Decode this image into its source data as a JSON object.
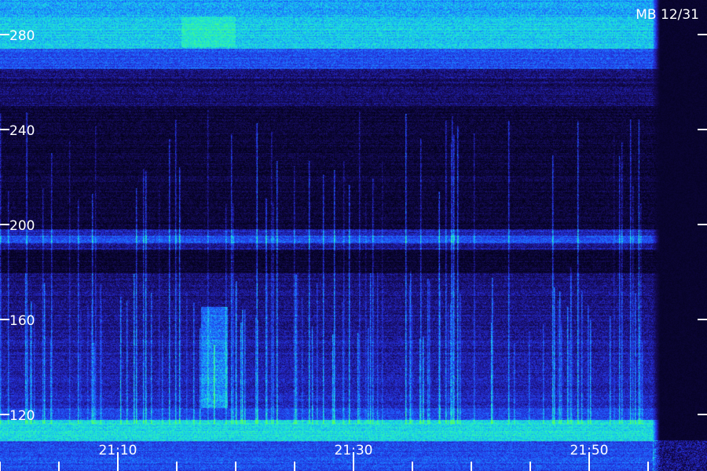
{
  "corner_label": "MB 12/31",
  "y_axis": {
    "ticks": [
      {
        "value": 280,
        "label": "280"
      },
      {
        "value": 240,
        "label": "240"
      },
      {
        "value": 200,
        "label": "200"
      },
      {
        "value": 160,
        "label": "160"
      },
      {
        "value": 120,
        "label": "120"
      }
    ]
  },
  "x_axis": {
    "labels": [
      {
        "time": "21:10",
        "label": "21:10"
      },
      {
        "time": "21:30",
        "label": "21:30"
      },
      {
        "time": "21:50",
        "label": "21:50"
      }
    ]
  },
  "palette": {
    "background": "#000000",
    "low": "#0c0a52",
    "mid": "#2a3cff",
    "high": "#27e9c4",
    "peak": "#44ff66",
    "axis": "#ffffff"
  }
}
